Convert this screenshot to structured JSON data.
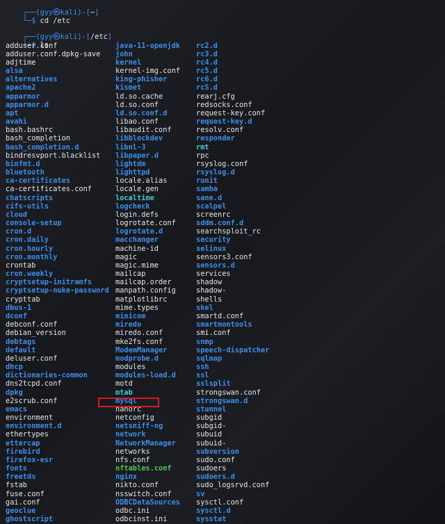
{
  "prompt1": {
    "user": "gyy",
    "host": "kali",
    "path": "~",
    "command": "cd /etc"
  },
  "prompt2": {
    "user": "gyy",
    "host": "kali",
    "path": "/etc",
    "command": "ls"
  },
  "symbols": {
    "skull": "㉿",
    "top_corner": "┌──(",
    "mid": ")-[",
    "close": "]",
    "bottom": "└─$"
  },
  "highlighted_entry": "mysql",
  "colors": {
    "directory": "#3b8eea",
    "file": "#e6e6e6",
    "highlight_box": "#e0161b",
    "background": "#1a1d21"
  },
  "columns": [
    [
      {
        "name": "adduser.conf",
        "type": "file"
      },
      {
        "name": "adduser.conf.dpkg-save",
        "type": "file"
      },
      {
        "name": "adjtime",
        "type": "file"
      },
      {
        "name": "alsa",
        "type": "dir"
      },
      {
        "name": "alternatives",
        "type": "dir"
      },
      {
        "name": "apache2",
        "type": "dir"
      },
      {
        "name": "apparmor",
        "type": "dir"
      },
      {
        "name": "apparmor.d",
        "type": "dir"
      },
      {
        "name": "apt",
        "type": "dir"
      },
      {
        "name": "avahi",
        "type": "dir"
      },
      {
        "name": "bash.bashrc",
        "type": "file"
      },
      {
        "name": "bash_completion",
        "type": "file"
      },
      {
        "name": "bash_completion.d",
        "type": "dir"
      },
      {
        "name": "bindresvport.blacklist",
        "type": "file"
      },
      {
        "name": "binfmt.d",
        "type": "dir"
      },
      {
        "name": "bluetooth",
        "type": "dir"
      },
      {
        "name": "ca-certificates",
        "type": "dir"
      },
      {
        "name": "ca-certificates.conf",
        "type": "file"
      },
      {
        "name": "chatscripts",
        "type": "dir"
      },
      {
        "name": "cifs-utils",
        "type": "dir"
      },
      {
        "name": "cloud",
        "type": "dir"
      },
      {
        "name": "console-setup",
        "type": "dir"
      },
      {
        "name": "cron.d",
        "type": "dir"
      },
      {
        "name": "cron.daily",
        "type": "dir"
      },
      {
        "name": "cron.hourly",
        "type": "dir"
      },
      {
        "name": "cron.monthly",
        "type": "dir"
      },
      {
        "name": "crontab",
        "type": "file"
      },
      {
        "name": "cron.weekly",
        "type": "dir"
      },
      {
        "name": "cryptsetup-initramfs",
        "type": "dir"
      },
      {
        "name": "cryptsetup-nuke-password",
        "type": "dir"
      },
      {
        "name": "crypttab",
        "type": "file"
      },
      {
        "name": "dbus-1",
        "type": "dir"
      },
      {
        "name": "dconf",
        "type": "dir"
      },
      {
        "name": "debconf.conf",
        "type": "file"
      },
      {
        "name": "debian_version",
        "type": "file"
      },
      {
        "name": "debtags",
        "type": "dir"
      },
      {
        "name": "default",
        "type": "dir"
      },
      {
        "name": "deluser.conf",
        "type": "file"
      },
      {
        "name": "dhcp",
        "type": "dir"
      },
      {
        "name": "dictionaries-common",
        "type": "dir"
      },
      {
        "name": "dns2tcpd.conf",
        "type": "file"
      },
      {
        "name": "dpkg",
        "type": "dir"
      },
      {
        "name": "e2scrub.conf",
        "type": "file"
      },
      {
        "name": "emacs",
        "type": "dir"
      },
      {
        "name": "environment",
        "type": "file"
      },
      {
        "name": "environment.d",
        "type": "dir"
      },
      {
        "name": "ethertypes",
        "type": "file"
      },
      {
        "name": "ettercap",
        "type": "dir"
      },
      {
        "name": "firebird",
        "type": "dir"
      },
      {
        "name": "firefox-esr",
        "type": "dir"
      },
      {
        "name": "fonts",
        "type": "dir"
      },
      {
        "name": "freetds",
        "type": "dir"
      },
      {
        "name": "fstab",
        "type": "file"
      },
      {
        "name": "fuse.conf",
        "type": "file"
      },
      {
        "name": "gai.conf",
        "type": "file"
      },
      {
        "name": "geoclue",
        "type": "dir"
      },
      {
        "name": "ghostscript",
        "type": "dir"
      }
    ],
    [
      {
        "name": "java-11-openjdk",
        "type": "dir"
      },
      {
        "name": "john",
        "type": "dir"
      },
      {
        "name": "kernel",
        "type": "dir"
      },
      {
        "name": "kernel-img.conf",
        "type": "file"
      },
      {
        "name": "king-phisher",
        "type": "dir"
      },
      {
        "name": "kismet",
        "type": "dir"
      },
      {
        "name": "ld.so.cache",
        "type": "file"
      },
      {
        "name": "ld.so.conf",
        "type": "file"
      },
      {
        "name": "ld.so.conf.d",
        "type": "dir"
      },
      {
        "name": "libao.conf",
        "type": "file"
      },
      {
        "name": "libaudit.conf",
        "type": "file"
      },
      {
        "name": "libblockdev",
        "type": "dir"
      },
      {
        "name": "libnl-3",
        "type": "dir"
      },
      {
        "name": "libpaper.d",
        "type": "dir"
      },
      {
        "name": "lightdm",
        "type": "dir"
      },
      {
        "name": "lighttpd",
        "type": "dir"
      },
      {
        "name": "locale.alias",
        "type": "file"
      },
      {
        "name": "locale.gen",
        "type": "file"
      },
      {
        "name": "localtime",
        "type": "link"
      },
      {
        "name": "logcheck",
        "type": "dir"
      },
      {
        "name": "login.defs",
        "type": "file"
      },
      {
        "name": "logrotate.conf",
        "type": "file"
      },
      {
        "name": "logrotate.d",
        "type": "dir"
      },
      {
        "name": "macchanger",
        "type": "dir"
      },
      {
        "name": "machine-id",
        "type": "file"
      },
      {
        "name": "magic",
        "type": "file"
      },
      {
        "name": "magic.mime",
        "type": "file"
      },
      {
        "name": "mailcap",
        "type": "file"
      },
      {
        "name": "mailcap.order",
        "type": "file"
      },
      {
        "name": "manpath.config",
        "type": "file"
      },
      {
        "name": "matplotlibrc",
        "type": "file"
      },
      {
        "name": "mime.types",
        "type": "file"
      },
      {
        "name": "minicom",
        "type": "dir"
      },
      {
        "name": "miredo",
        "type": "dir"
      },
      {
        "name": "miredo.conf",
        "type": "file"
      },
      {
        "name": "mke2fs.conf",
        "type": "file"
      },
      {
        "name": "ModemManager",
        "type": "dir"
      },
      {
        "name": "modprobe.d",
        "type": "dir"
      },
      {
        "name": "modules",
        "type": "file"
      },
      {
        "name": "modules-load.d",
        "type": "dir"
      },
      {
        "name": "motd",
        "type": "file"
      },
      {
        "name": "mtab",
        "type": "link"
      },
      {
        "name": "mysql",
        "type": "dir"
      },
      {
        "name": "nanorc",
        "type": "file"
      },
      {
        "name": "netconfig",
        "type": "file"
      },
      {
        "name": "netsniff-ng",
        "type": "dir"
      },
      {
        "name": "network",
        "type": "dir"
      },
      {
        "name": "NetworkManager",
        "type": "dir"
      },
      {
        "name": "networks",
        "type": "file"
      },
      {
        "name": "nfs.conf",
        "type": "file"
      },
      {
        "name": "nftables.conf",
        "type": "exec"
      },
      {
        "name": "nginx",
        "type": "dir"
      },
      {
        "name": "nikto.conf",
        "type": "file"
      },
      {
        "name": "nsswitch.conf",
        "type": "file"
      },
      {
        "name": "ODBCDataSources",
        "type": "dir"
      },
      {
        "name": "odbc.ini",
        "type": "file"
      },
      {
        "name": "odbcinst.ini",
        "type": "file"
      }
    ],
    [
      {
        "name": "rc2.d",
        "type": "dir"
      },
      {
        "name": "rc3.d",
        "type": "dir"
      },
      {
        "name": "rc4.d",
        "type": "dir"
      },
      {
        "name": "rc5.d",
        "type": "dir"
      },
      {
        "name": "rc6.d",
        "type": "dir"
      },
      {
        "name": "rcS.d",
        "type": "dir"
      },
      {
        "name": "rearj.cfg",
        "type": "file"
      },
      {
        "name": "redsocks.conf",
        "type": "file"
      },
      {
        "name": "request-key.conf",
        "type": "file"
      },
      {
        "name": "request-key.d",
        "type": "dir"
      },
      {
        "name": "resolv.conf",
        "type": "file"
      },
      {
        "name": "responder",
        "type": "dir"
      },
      {
        "name": "rmt",
        "type": "link"
      },
      {
        "name": "rpc",
        "type": "file"
      },
      {
        "name": "rsyslog.conf",
        "type": "file"
      },
      {
        "name": "rsyslog.d",
        "type": "dir"
      },
      {
        "name": "runit",
        "type": "dir"
      },
      {
        "name": "samba",
        "type": "dir"
      },
      {
        "name": "sane.d",
        "type": "dir"
      },
      {
        "name": "scalpel",
        "type": "dir"
      },
      {
        "name": "screenrc",
        "type": "file"
      },
      {
        "name": "sddm.conf.d",
        "type": "dir"
      },
      {
        "name": "searchsploit_rc",
        "type": "file"
      },
      {
        "name": "security",
        "type": "dir"
      },
      {
        "name": "selinux",
        "type": "dir"
      },
      {
        "name": "sensors3.conf",
        "type": "file"
      },
      {
        "name": "sensors.d",
        "type": "dir"
      },
      {
        "name": "services",
        "type": "file"
      },
      {
        "name": "shadow",
        "type": "file"
      },
      {
        "name": "shadow-",
        "type": "file"
      },
      {
        "name": "shells",
        "type": "file"
      },
      {
        "name": "skel",
        "type": "dir"
      },
      {
        "name": "smartd.conf",
        "type": "file"
      },
      {
        "name": "smartmontools",
        "type": "dir"
      },
      {
        "name": "smi.conf",
        "type": "file"
      },
      {
        "name": "snmp",
        "type": "dir"
      },
      {
        "name": "speech-dispatcher",
        "type": "dir"
      },
      {
        "name": "sqlmap",
        "type": "dir"
      },
      {
        "name": "ssh",
        "type": "dir"
      },
      {
        "name": "ssl",
        "type": "dir"
      },
      {
        "name": "sslsplit",
        "type": "dir"
      },
      {
        "name": "strongswan.conf",
        "type": "file"
      },
      {
        "name": "strongswan.d",
        "type": "dir"
      },
      {
        "name": "stunnel",
        "type": "dir"
      },
      {
        "name": "subgid",
        "type": "file"
      },
      {
        "name": "subgid-",
        "type": "file"
      },
      {
        "name": "subuid",
        "type": "file"
      },
      {
        "name": "subuid-",
        "type": "file"
      },
      {
        "name": "subversion",
        "type": "dir"
      },
      {
        "name": "sudo.conf",
        "type": "file"
      },
      {
        "name": "sudoers",
        "type": "file"
      },
      {
        "name": "sudoers.d",
        "type": "dir"
      },
      {
        "name": "sudo_logsrvd.conf",
        "type": "file"
      },
      {
        "name": "sv",
        "type": "dir"
      },
      {
        "name": "sysctl.conf",
        "type": "file"
      },
      {
        "name": "sysctl.d",
        "type": "dir"
      },
      {
        "name": "sysstat",
        "type": "dir"
      }
    ]
  ]
}
